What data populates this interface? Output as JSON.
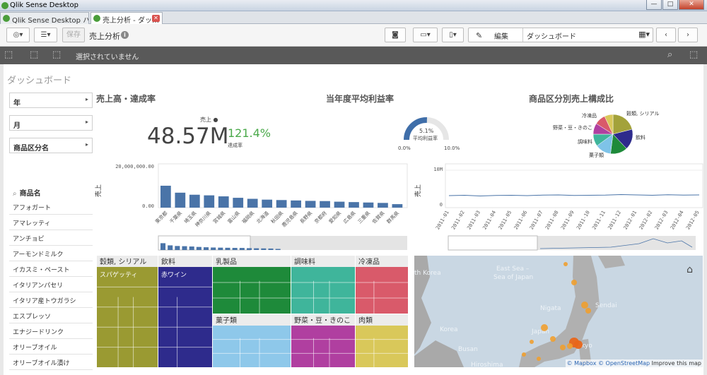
{
  "window": {
    "title": "Qlik Sense Desktop"
  },
  "tabs": [
    {
      "label": "Qlik Sense Desktop ハブ"
    },
    {
      "label": "売上分析 - ダッ…"
    }
  ],
  "toolbar": {
    "save_label": "保存",
    "sheet_title": "売上分析",
    "edit_label": "編集",
    "current_sheet": "ダッシュボード"
  },
  "selections": {
    "status": "選択されていません"
  },
  "sheet": {
    "heading": "ダッシュボード"
  },
  "filters": [
    {
      "label": "年"
    },
    {
      "label": "月"
    },
    {
      "label": "商品区分名"
    }
  ],
  "listbox": {
    "title": "商品名",
    "items": [
      "アフォガート",
      "アマレッティ",
      "アンチョビ",
      "アーモンドミルク",
      "イカスミ・ペースト",
      "イタリアンパセリ",
      "イタリア産トウガラシ",
      "エスプレッソ",
      "エナジードリンク",
      "オリーブオイル",
      "オリーブオイル漬け"
    ]
  },
  "kpi": {
    "title": "売上高・達成率",
    "label": "売上",
    "value": "48.57M",
    "second_value": "121.4%",
    "second_label": "達成率",
    "colors": {
      "primary": "#444444",
      "positive": "#4aa94a"
    }
  },
  "gauge": {
    "title": "当年度平均利益率",
    "value_label": "5.1%",
    "measure_label": "平均利益率",
    "min_label": "0.0%",
    "max_label": "10.0%",
    "value": 5.1,
    "min": 0,
    "max": 10,
    "color": "#3f6ea9"
  },
  "pie_title": "商品区分別売上構成比",
  "chart_data": [
    {
      "type": "pie",
      "title": "商品区分別売上構成比",
      "slices": [
        {
          "label": "穀類, シリアル",
          "value": 21,
          "color": "#a3a23a"
        },
        {
          "label": "飲料",
          "value": 17,
          "color": "#2e2b8c"
        },
        {
          "label": "乳製品",
          "value": 14,
          "color": "#1e8a3a"
        },
        {
          "label": "菓子類",
          "value": 13,
          "color": "#7ec3e8"
        },
        {
          "label": "調味料",
          "value": 10,
          "color": "#3fb59b"
        },
        {
          "label": "野菜・豆・きのこ",
          "value": 9,
          "color": "#b03fa0"
        },
        {
          "label": "冷凍品",
          "value": 9,
          "color": "#d95a6a"
        },
        {
          "label": "肉類",
          "value": 7,
          "color": "#d9c85a"
        }
      ]
    },
    {
      "type": "bar",
      "title": "",
      "ylabel": "売上",
      "ytick_labels": [
        "20,000,000.00",
        "0.00"
      ],
      "ylim": [
        0,
        20000000
      ],
      "categories": [
        "東京都",
        "千葉県",
        "埼玉県",
        "神奈川県",
        "宮城県",
        "富山県",
        "福岡県",
        "北海道",
        "秋田県",
        "鹿児島県",
        "長野県",
        "京都府",
        "愛知県",
        "広島県",
        "三重県",
        "佐賀県",
        "群馬県"
      ],
      "values": [
        10700000,
        7300000,
        6300000,
        6000000,
        5500000,
        4800000,
        4300000,
        3900000,
        3700000,
        3500000,
        3300000,
        3200000,
        2900000,
        2700000,
        2500000,
        2300000,
        1700000
      ],
      "color": "#4a74a8"
    },
    {
      "type": "line",
      "title": "",
      "ylabel": "売上",
      "ytick_labels": [
        "10M",
        "0"
      ],
      "ylim": [
        0,
        10000000
      ],
      "x": [
        "2011-01",
        "2011-02",
        "2011-03",
        "2011-04",
        "2011-05",
        "2011-06",
        "2011-07",
        "2011-08",
        "2011-09",
        "2011-10",
        "2011-11",
        "2011-12",
        "2012-01",
        "2012-02",
        "2012-03",
        "2012-04",
        "2012-05"
      ],
      "values": [
        2600000,
        2700000,
        2500000,
        2650000,
        2700000,
        2600000,
        2750000,
        2800000,
        2650000,
        2700000,
        2750000,
        2900000,
        2800000,
        2700000,
        2850000,
        2750000,
        2800000
      ],
      "color": "#4a74a8"
    },
    {
      "type": "heatmap",
      "title": "",
      "categories": [
        {
          "label": "穀類, シリアル",
          "sub_label": "スパゲッティ",
          "color": "#9a9a32"
        },
        {
          "label": "飲料",
          "sub_label": "赤ワイン",
          "color": "#2e2b8c"
        },
        {
          "label": "乳製品",
          "color": "#1e8a3a"
        },
        {
          "label": "調味料",
          "color": "#3fb59b"
        },
        {
          "label": "冷凍品",
          "color": "#d95a6a"
        },
        {
          "label": "菓子類",
          "color": "#8ec8ea"
        },
        {
          "label": "野菜・豆・きのこ",
          "color": "#b03fa0"
        },
        {
          "label": "肉類",
          "color": "#d9c85a"
        }
      ]
    }
  ],
  "map": {
    "labels": [
      "East Sea –",
      "Sea of Japan",
      "th Korea",
      "Nigata",
      "Sendai",
      "Japan",
      "Korea",
      "Busan",
      "Hiroshima",
      "kyo"
    ],
    "attribution_mapbox": "© Mapbox",
    "attribution_osm": "© OpenStreetMap",
    "attribution_improve": "Improve this map"
  }
}
